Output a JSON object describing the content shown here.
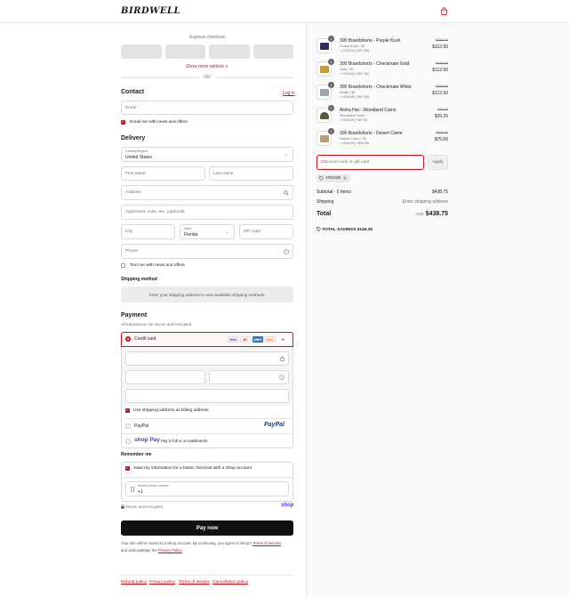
{
  "header": {
    "logo": "BIRDWELL",
    "cart_icon": "shopping-bag-icon"
  },
  "express": {
    "label": "Express checkout",
    "show_more": "Show more options ∨",
    "or": "OR"
  },
  "contact": {
    "title": "Contact",
    "login": "Log in",
    "email_placeholder": "Email",
    "email_news_label": "Email me with news and offers"
  },
  "delivery": {
    "title": "Delivery",
    "country_label": "Country/Region",
    "country_value": "United States",
    "first_name": "First name",
    "last_name": "Last name",
    "address": "Address",
    "apartment": "Apartment, suite, etc. (optional)",
    "city": "City",
    "state_label": "State",
    "state_value": "Florida",
    "zip": "ZIP code",
    "phone": "Phone",
    "text_me_label": "Text me with news and offers"
  },
  "shipping_method": {
    "title": "Shipping method",
    "message": "Enter your shipping address to view available shipping methods."
  },
  "payment": {
    "title": "Payment",
    "subtitle": "All transactions are secure and encrypted.",
    "credit_card": "Credit card",
    "card_brands": [
      "VISA",
      "MC",
      "AMEX",
      "DISC",
      "+6"
    ],
    "billing_label": "Use shipping address as billing address",
    "paypal": "PayPal",
    "paypal_logo": "PayPal",
    "shop_pay_logo": "shop Pay",
    "shop_pay_text": "Pay in full or in installments"
  },
  "remember": {
    "title": "Remember me",
    "save_label": "Save my information for a faster checkout with a Shop account",
    "phone_label": "Mobile phone number",
    "phone_value": "+1",
    "secure_text": "Secure and encrypted",
    "shop_logo": "shop"
  },
  "pay_now": "Pay now",
  "legal": {
    "line1": "Your info will be saved to a Shop account. By continuing, you agree to Shop's",
    "terms": "Terms of Service",
    "line2": "and acknowledge the",
    "privacy": "Privacy Policy"
  },
  "footer_links": [
    "Refund policy",
    "Privacy policy",
    "Terms of service",
    "Cancellation policy"
  ],
  "cart": {
    "items": [
      {
        "qty": "1",
        "name": "300 Boardshorts - Purple Kush",
        "variant": "Purple Kush / 38",
        "discount": "HOA25 (−$37.50)",
        "compare": "$150.00",
        "price": "$112.50",
        "color": "#2e2f5a"
      },
      {
        "qty": "1",
        "name": "300 Boardshorts - Checkmate Gold",
        "variant": "Gold / 36",
        "discount": "HOA25 (−$37.50)",
        "compare": "$150.00",
        "price": "$112.50",
        "color": "#c99a2e"
      },
      {
        "qty": "1",
        "name": "300 Boardshorts - Checkmate White",
        "variant": "White / 36",
        "discount": "HOA25 (−$37.50)",
        "compare": "$150.00",
        "price": "$112.50",
        "color": "#9ea6ad"
      },
      {
        "qty": "1",
        "name": "Aloha Hat - Woodland Camo",
        "variant": "Woodland Camo",
        "discount": "HOA25 (−$8.75)",
        "compare": "$35.00",
        "price": "$26.25",
        "color": "#4f5a2f"
      },
      {
        "qty": "1",
        "name": "300 Boardshorts - Desert Camo",
        "variant": "Desert Camo / 38",
        "discount": "HOA25 (−$25.00)",
        "compare": "$100.00",
        "price": "$75.00",
        "color": "#b79d78"
      }
    ],
    "discount_placeholder": "Discount code or gift card",
    "apply": "Apply",
    "applied_code": "HOA25",
    "subtotal_label": "Subtotal · 5 items",
    "subtotal_value": "$438.75",
    "shipping_label": "Shipping",
    "shipping_value": "Enter shipping address",
    "total_label": "Total",
    "currency": "USD",
    "total_value": "$438.75",
    "savings_label": "TOTAL SAVINGS",
    "savings_value": "$146.25"
  },
  "colors": {
    "accent": "#c4161c",
    "button": "#111111"
  }
}
